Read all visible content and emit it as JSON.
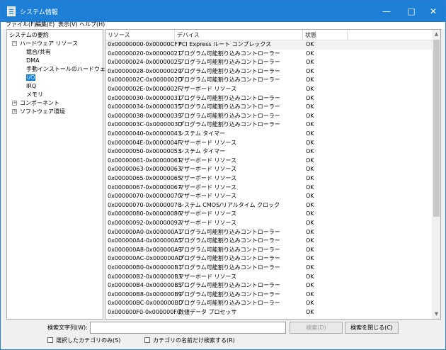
{
  "window": {
    "title": "システム情報",
    "controls": {
      "minimize": "—",
      "maximize": "□",
      "close": "✕"
    }
  },
  "menu": [
    "ファイル(F)",
    "編集(E)",
    "表示(V)",
    "ヘルプ(H)"
  ],
  "tree": [
    {
      "label": "システムの要約",
      "expander": "",
      "selected": false
    },
    {
      "label": "ハードウェア リソース",
      "expander": "−",
      "selected": false
    },
    {
      "label": "競合/共有",
      "expander": "",
      "selected": false
    },
    {
      "label": "DMA",
      "expander": "",
      "selected": false
    },
    {
      "label": "手動インストールのハードウェア",
      "expander": "",
      "selected": false
    },
    {
      "label": "I/O",
      "expander": "",
      "selected": true
    },
    {
      "label": "IRQ",
      "expander": "",
      "selected": false
    },
    {
      "label": "メモリ",
      "expander": "",
      "selected": false
    },
    {
      "label": "コンポーネント",
      "expander": "+",
      "selected": false
    },
    {
      "label": "ソフトウェア環境",
      "expander": "+",
      "selected": false
    }
  ],
  "table": {
    "columns": [
      "リソース",
      "デバイス",
      "状態"
    ],
    "rows": [
      [
        "0x00000000-0x00000CF7",
        "PCI Express ルート コンプレックス",
        "OK"
      ],
      [
        "0x00000020-0x00000021",
        "プログラム可能割り込みコントローラー",
        "OK"
      ],
      [
        "0x00000024-0x00000025",
        "プログラム可能割り込みコントローラー",
        "OK"
      ],
      [
        "0x00000028-0x00000029",
        "プログラム可能割り込みコントローラー",
        "OK"
      ],
      [
        "0x0000002C-0x0000002D",
        "プログラム可能割り込みコントローラー",
        "OK"
      ],
      [
        "0x0000002E-0x0000002F",
        "マザーボード リソース",
        "OK"
      ],
      [
        "0x00000030-0x00000031",
        "プログラム可能割り込みコントローラー",
        "OK"
      ],
      [
        "0x00000034-0x00000035",
        "プログラム可能割り込みコントローラー",
        "OK"
      ],
      [
        "0x00000038-0x00000039",
        "プログラム可能割り込みコントローラー",
        "OK"
      ],
      [
        "0x0000003C-0x0000003D",
        "プログラム可能割り込みコントローラー",
        "OK"
      ],
      [
        "0x00000040-0x00000043",
        "システム タイマー",
        "OK"
      ],
      [
        "0x0000004E-0x0000004F",
        "マザーボード リソース",
        "OK"
      ],
      [
        "0x00000050-0x00000053",
        "システム タイマー",
        "OK"
      ],
      [
        "0x00000061-0x00000061",
        "マザーボード リソース",
        "OK"
      ],
      [
        "0x00000063-0x00000063",
        "マザーボード リソース",
        "OK"
      ],
      [
        "0x00000065-0x00000065",
        "マザーボード リソース",
        "OK"
      ],
      [
        "0x00000067-0x00000067",
        "マザーボード リソース",
        "OK"
      ],
      [
        "0x00000070-0x00000070",
        "マザーボード リソース",
        "OK"
      ],
      [
        "0x00000070-0x00000070",
        "システム CMOS/リアルタイム クロック",
        "OK"
      ],
      [
        "0x00000080-0x00000080",
        "マザーボード リソース",
        "OK"
      ],
      [
        "0x00000092-0x00000092",
        "マザーボード リソース",
        "OK"
      ],
      [
        "0x000000A0-0x000000A1",
        "プログラム可能割り込みコントローラー",
        "OK"
      ],
      [
        "0x000000A4-0x000000A5",
        "プログラム可能割り込みコントローラー",
        "OK"
      ],
      [
        "0x000000A8-0x000000A9",
        "プログラム可能割り込みコントローラー",
        "OK"
      ],
      [
        "0x000000AC-0x000000AD",
        "プログラム可能割り込みコントローラー",
        "OK"
      ],
      [
        "0x000000B0-0x000000B1",
        "プログラム可能割り込みコントローラー",
        "OK"
      ],
      [
        "0x000000B2-0x000000B3",
        "マザーボード リソース",
        "OK"
      ],
      [
        "0x000000B4-0x000000B5",
        "プログラム可能割り込みコントローラー",
        "OK"
      ],
      [
        "0x000000B8-0x000000B9",
        "プログラム可能割り込みコントローラー",
        "OK"
      ],
      [
        "0x000000BC-0x000000BD",
        "プログラム可能割り込みコントローラー",
        "OK"
      ],
      [
        "0x000000F0-0x000000F0",
        "数値データ プロセッサ",
        "OK"
      ]
    ]
  },
  "search": {
    "label": "検索文字列(W):",
    "value": "",
    "search_button": "検索(D)",
    "close_button": "検索を閉じる(C)",
    "selected_category_only": "選択したカテゴリのみ(S)",
    "category_name_only": "カテゴリの名前だけ検索する(R)"
  },
  "icons": {
    "app": "system-info-icon",
    "tree_expand": "plus-box-icon",
    "tree_collapse": "minus-box-icon"
  }
}
